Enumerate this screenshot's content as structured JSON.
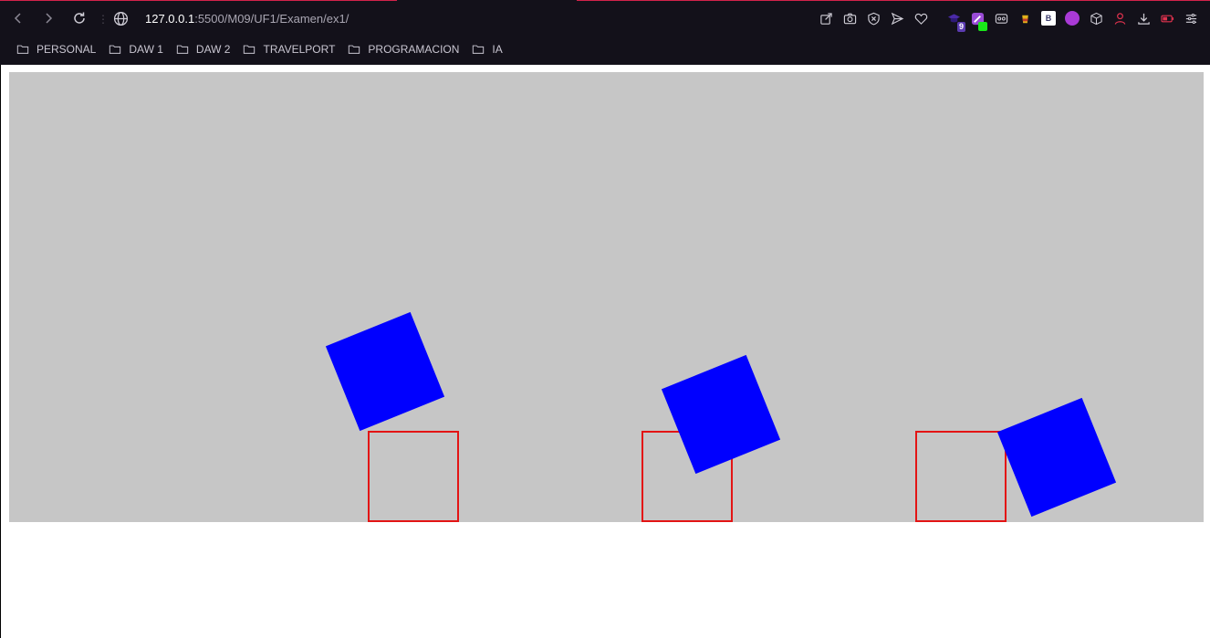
{
  "browser": {
    "url_host": "127.0.0.1",
    "url_path": ":5500/M09/UF1/Examen/ex1/",
    "extension_badge": "9",
    "extension_letter": "B"
  },
  "bookmarks": [
    {
      "label": "PERSONAL"
    },
    {
      "label": "DAW 1"
    },
    {
      "label": "DAW 2"
    },
    {
      "label": "TRAVELPORT"
    },
    {
      "label": "PROGRAMACION"
    },
    {
      "label": "IA"
    }
  ],
  "colors": {
    "stage_background": "#c6c6c6",
    "square_fill": "#0000ff",
    "target_border": "#e31414",
    "browser_frame": "#13111a",
    "accent": "#d2224a"
  },
  "icons": [
    "back-icon",
    "forward-icon",
    "reload-icon",
    "globe-icon",
    "edit-share-icon",
    "camera-icon",
    "shield-x-icon",
    "send-icon",
    "heart-icon",
    "download-icon",
    "battery-icon",
    "menu-icon"
  ]
}
